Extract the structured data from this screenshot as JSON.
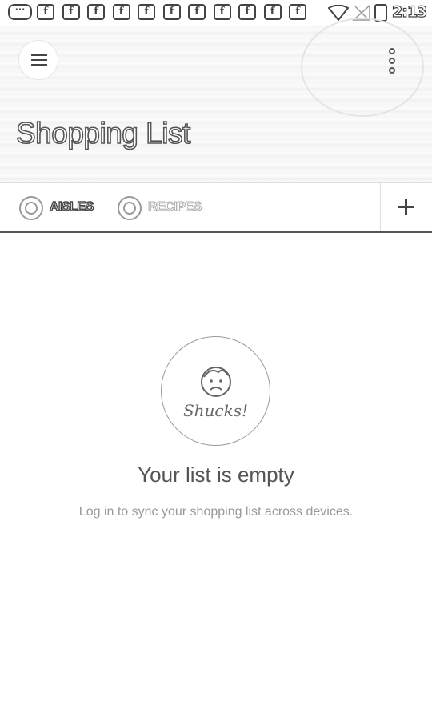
{
  "status_bar": {
    "message_icon_label": "···",
    "notification_icon_label": "f",
    "notification_count": 11,
    "time": "2:13"
  },
  "header": {
    "title": "Shopping List"
  },
  "tabs": [
    {
      "label": "AISLES"
    },
    {
      "label": "RECIPES"
    }
  ],
  "empty_state": {
    "badge_text": "Shucks!",
    "title": "Your list is empty",
    "subtitle": "Log in to sync your shopping list across devices."
  },
  "icons": {
    "menu": "hamburger-menu-icon",
    "overflow": "overflow-vertical-icon",
    "add": "plus-icon",
    "face": "sad-face-icon"
  }
}
